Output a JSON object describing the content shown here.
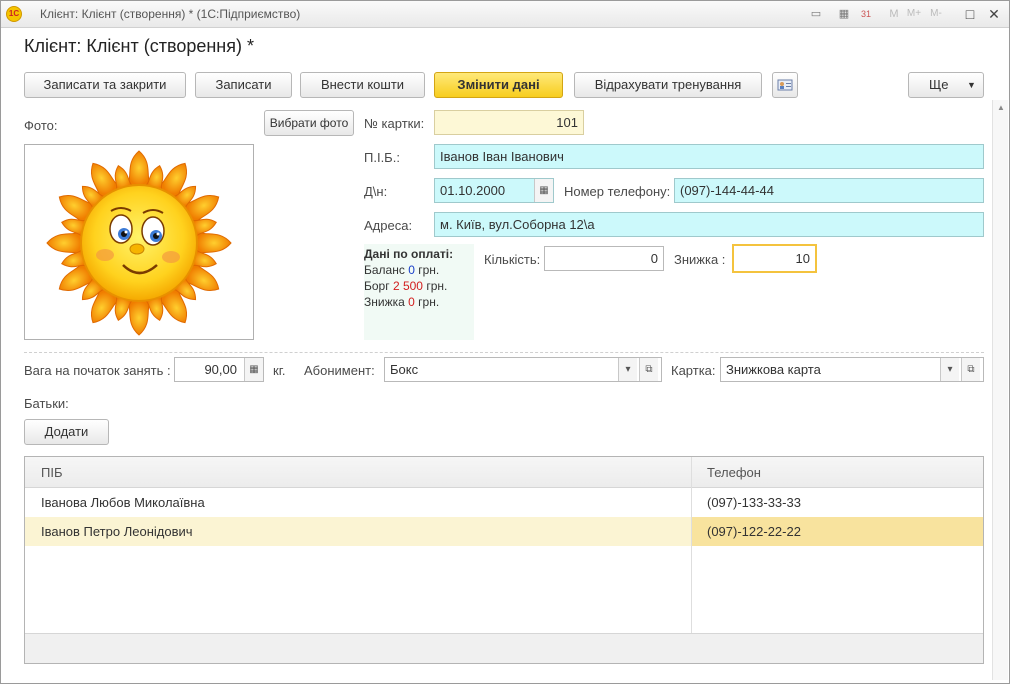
{
  "window": {
    "logo_text": "1С",
    "title": "Клієнт: Клієнт (створення) * (1С:Підприємство)",
    "toolbar_icons": [
      "document-icon",
      "calculator-icon",
      "calendar-icon",
      "m-icon",
      "m-plus-icon",
      "m-minus-icon"
    ],
    "m_label": "M",
    "m_plus_label": "M+",
    "m_minus_label": "M-",
    "cal_label": "31"
  },
  "form": {
    "title": "Клієнт: Клієнт (створення) *"
  },
  "toolbar": {
    "save_close": "Записати та закрити",
    "save": "Записати",
    "deposit": "Внести кошти",
    "change_data": "Змінити дані",
    "count_training": "Відрахувати тренування",
    "more": "Ще"
  },
  "photo": {
    "label": "Фото:",
    "choose_button": "Вибрати фото"
  },
  "fields": {
    "card_number_label": "№ картки:",
    "card_number": "101",
    "name_label": "П.І.Б.:",
    "name": "Іванов Іван Іванович",
    "dob_label": "Д\\н:",
    "dob": "01.10.2000",
    "phone_label": "Номер телефону:",
    "phone": "(097)-144-44-44",
    "address_label": "Адреса:",
    "address": "м. Київ, вул.Соборна 12\\а",
    "quantity_label": "Кількість:",
    "quantity": "0",
    "discount_label": "Знижка :",
    "discount": "10",
    "weight_label": "Вага на початок занять :",
    "weight": "90,00",
    "weight_unit": "кг.",
    "subscription_label": "Абонимент:",
    "subscription": "Бокс",
    "card_label": "Картка:",
    "card": "Знижкова карта"
  },
  "payment": {
    "header": "Дані по оплаті:",
    "balance_label": "Баланс",
    "balance": "0",
    "debt_label": "Борг",
    "debt": "2 500",
    "discount_label": "Знижка",
    "discount": "0",
    "currency": "грн.",
    "colors": {
      "balance": "#1a3fc9",
      "debt": "#d21e1e"
    }
  },
  "parents": {
    "label": "Батьки:",
    "add_button": "Додати",
    "columns": [
      "ПІБ",
      "Телефон"
    ],
    "rows": [
      {
        "name": "Іванова Любов Миколаївна",
        "phone": "(097)-133-33-33"
      },
      {
        "name": "Іванов Петро Леонідович",
        "phone": "(097)-122-22-22"
      }
    ]
  },
  "colors": {
    "accent_button": "#f7cd1e",
    "required_field": "#ccf9fb",
    "readonly_field": "#fdf8d6",
    "selected_row": "#fbf4d3"
  }
}
